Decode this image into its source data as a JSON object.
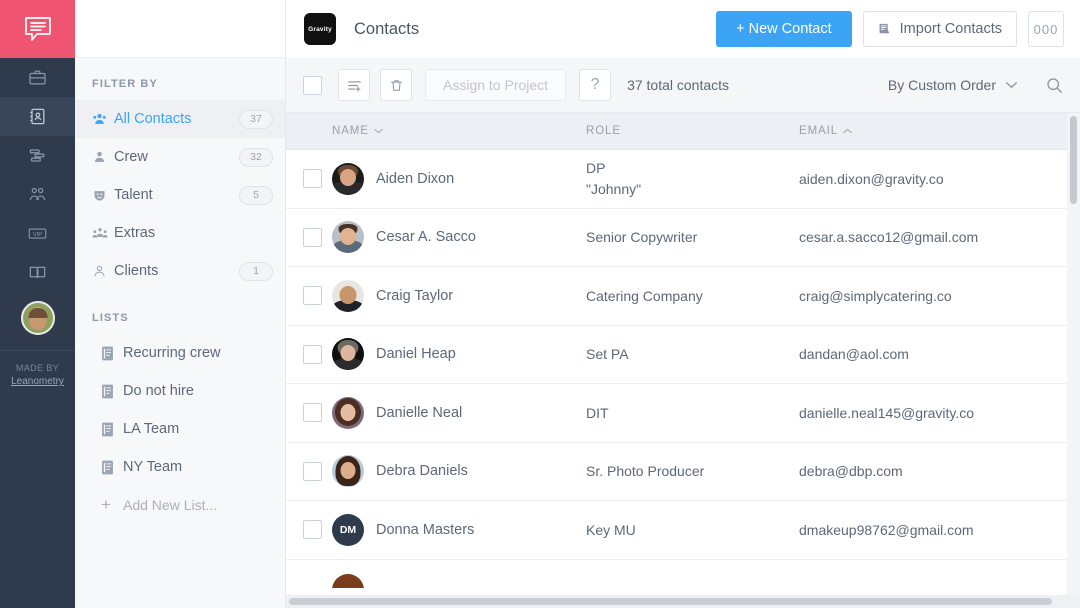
{
  "app": {
    "brand_icon": "chat-bubble-logo",
    "accent_pink": "#ef5571",
    "accent_blue": "#3ba4f5",
    "rail_bg": "#2f3a4c"
  },
  "rail": {
    "items": [
      {
        "icon": "briefcase-icon",
        "name": "projects"
      },
      {
        "icon": "contacts-book-icon",
        "name": "contacts",
        "active": true
      },
      {
        "icon": "schedule-icon",
        "name": "schedule"
      },
      {
        "icon": "crew-group-icon",
        "name": "crew"
      },
      {
        "icon": "vip-badge-icon",
        "name": "vip"
      },
      {
        "icon": "open-book-icon",
        "name": "library"
      }
    ],
    "made_by_label": "MADE BY",
    "made_by_name": "Leanometry"
  },
  "header": {
    "workspace_logo_text": "Gravity",
    "title": "Contacts",
    "new_contact_label": "+ New Contact",
    "import_contacts_label": "Import Contacts",
    "more_label": "000"
  },
  "sidebar": {
    "filter_title": "FILTER BY",
    "filters": [
      {
        "label": "All Contacts",
        "count": "37",
        "icon": "contacts-all-icon",
        "active": true
      },
      {
        "label": "Crew",
        "count": "32",
        "icon": "crew-icon",
        "active": false
      },
      {
        "label": "Talent",
        "count": "5",
        "icon": "talent-mask-icon",
        "active": false
      },
      {
        "label": "Extras",
        "count": "",
        "icon": "extras-icon",
        "active": false
      },
      {
        "label": "Clients",
        "count": "1",
        "icon": "client-icon",
        "active": false
      }
    ],
    "lists_title": "LISTS",
    "lists": [
      {
        "label": "Recurring crew",
        "icon": "list-icon"
      },
      {
        "label": "Do not hire",
        "icon": "list-icon"
      },
      {
        "label": "LA Team",
        "icon": "list-icon"
      },
      {
        "label": "NY Team",
        "icon": "list-icon"
      }
    ],
    "add_list_label": "Add New List..."
  },
  "toolbar": {
    "select_all_name": "select-all-checkbox",
    "add_to_list_icon": "add-to-list-icon",
    "delete_icon": "trash-icon",
    "assign_label": "Assign to Project",
    "assign_disabled": true,
    "help_label": "?",
    "total_label": "37 total contacts",
    "sort_label": "By Custom Order",
    "search_icon": "search-icon"
  },
  "table": {
    "columns": [
      {
        "label": "NAME",
        "sort": "down"
      },
      {
        "label": "ROLE",
        "sort": ""
      },
      {
        "label": "EMAIL",
        "sort": "up"
      }
    ],
    "rows": [
      {
        "name": "Aiden Dixon",
        "role": "DP",
        "role2": "\"Johnny\"",
        "email": "aiden.dixon@gravity.co",
        "avatar": "photo",
        "skin": "#d8a684",
        "hair": "#6b4a30",
        "bg": "#1c1b1a",
        "initials": ""
      },
      {
        "name": "Cesar A. Sacco",
        "role": "Senior Copywriter",
        "role2": "",
        "email": "cesar.a.sacco12@gmail.com",
        "avatar": "photo",
        "skin": "#e0b391",
        "hair": "#4a3326",
        "bg": "#b9bfc6",
        "initials": ""
      },
      {
        "name": "Craig Taylor",
        "role": "Catering Company",
        "role2": "",
        "email": "craig@simplycatering.co",
        "avatar": "photo",
        "skin": "#c9956a",
        "hair": "#2b2119",
        "bg": "#e8e6e2",
        "initials": ""
      },
      {
        "name": "Daniel Heap",
        "role": "Set PA",
        "role2": "",
        "email": "dandan@aol.com",
        "avatar": "photo",
        "skin": "#dcb79b",
        "hair": "#6d6a66",
        "bg": "#12110f",
        "initials": ""
      },
      {
        "name": "Danielle Neal",
        "role": "DIT",
        "role2": "",
        "email": "danielle.neal145@gravity.co",
        "avatar": "photo",
        "skin": "#e6bda0",
        "hair": "#4a2e24",
        "bg": "#7d6a78",
        "initials": ""
      },
      {
        "name": "Debra Daniels",
        "role": "Sr. Photo Producer",
        "role2": "",
        "email": "debra@dbp.com",
        "avatar": "photo",
        "skin": "#dcae8c",
        "hair": "#3a2418",
        "bg": "#b9cad6",
        "initials": ""
      },
      {
        "name": "Donna Masters",
        "role": "Key MU",
        "role2": "",
        "email": "dmakeup98762@gmail.com",
        "avatar": "initials",
        "skin": "",
        "hair": "",
        "bg": "#2f3a4c",
        "initials": "DM"
      }
    ],
    "partial_row": {
      "avatar_bg": "#7a3d1c"
    }
  }
}
